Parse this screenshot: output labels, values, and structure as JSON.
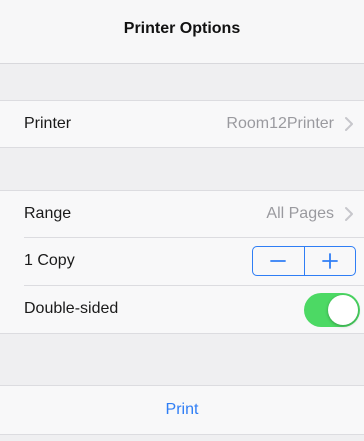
{
  "header": {
    "title": "Printer Options"
  },
  "printer_row": {
    "label": "Printer",
    "value": "Room12Printer"
  },
  "range_row": {
    "label": "Range",
    "value": "All Pages"
  },
  "copies_row": {
    "label": "1 Copy",
    "count": 1
  },
  "double_sided_row": {
    "label": "Double-sided",
    "enabled": true
  },
  "print_action": {
    "label": "Print"
  },
  "colors": {
    "accent": "#2f7ef5",
    "toggle_on": "#4cd964",
    "secondary_text": "#9a9a9f"
  },
  "icons": [
    "chevron-right-icon",
    "minus-icon",
    "plus-icon"
  ]
}
